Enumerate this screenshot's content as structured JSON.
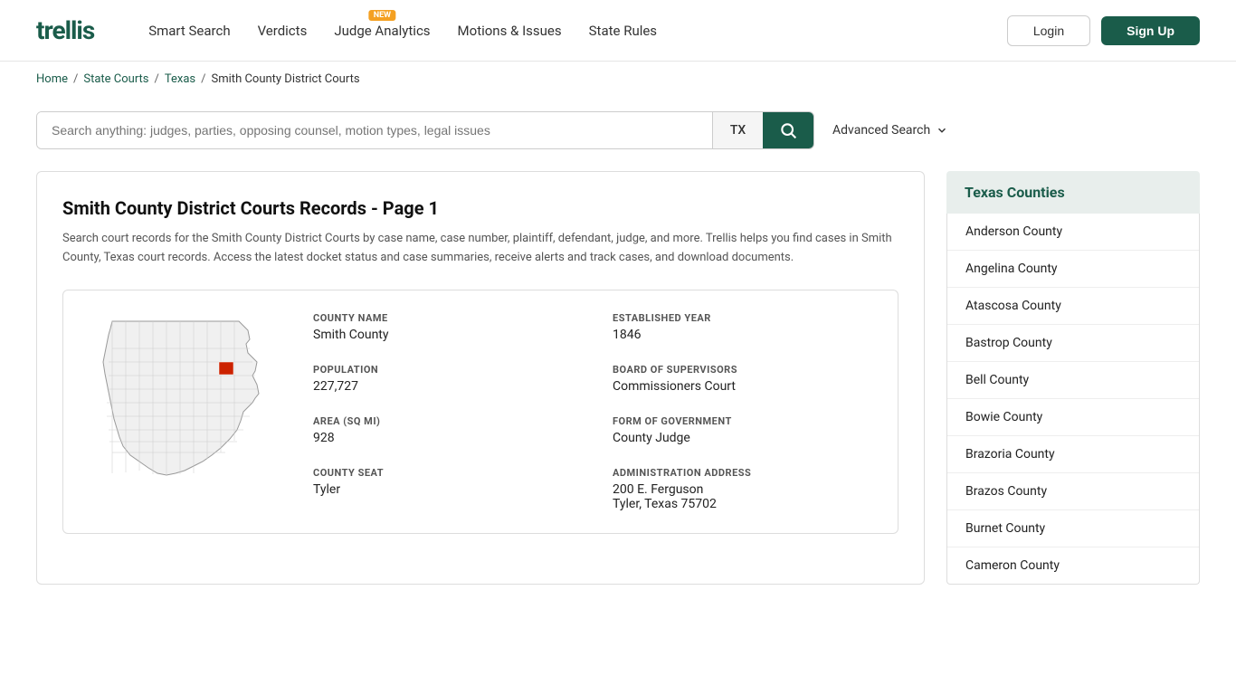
{
  "header": {
    "logo": "trellis",
    "nav": [
      {
        "id": "smart-search",
        "label": "Smart Search",
        "badge": null
      },
      {
        "id": "verdicts",
        "label": "Verdicts",
        "badge": null
      },
      {
        "id": "judge-analytics",
        "label": "Judge Analytics",
        "badge": "NEW"
      },
      {
        "id": "motions-issues",
        "label": "Motions & Issues",
        "badge": null
      },
      {
        "id": "state-rules",
        "label": "State Rules",
        "badge": null
      }
    ],
    "login_label": "Login",
    "signup_label": "Sign Up"
  },
  "breadcrumb": {
    "items": [
      {
        "label": "Home",
        "href": "#"
      },
      {
        "label": "State Courts",
        "href": "#"
      },
      {
        "label": "Texas",
        "href": "#"
      },
      {
        "label": "Smith County District Courts",
        "href": null
      }
    ]
  },
  "search": {
    "placeholder": "Search anything: judges, parties, opposing counsel, motion types, legal issues",
    "state_code": "TX",
    "advanced_label": "Advanced Search"
  },
  "main": {
    "page_title": "Smith County District Courts Records - Page 1",
    "page_desc": "Search court records for the Smith County District Courts by case name, case number, plaintiff, defendant, judge, and more. Trellis helps you find cases in Smith County, Texas court records. Access the latest docket status and case summaries, receive alerts and track cases, and download documents.",
    "county": {
      "name_label": "COUNTY NAME",
      "name_value": "Smith County",
      "population_label": "POPULATION",
      "population_value": "227,727",
      "area_label": "AREA (SQ MI)",
      "area_value": "928",
      "seat_label": "COUNTY SEAT",
      "seat_value": "Tyler",
      "address_label": "ADMINISTRATION ADDRESS",
      "address_line1": "200 E. Ferguson",
      "address_line2": "Tyler, Texas 75702",
      "established_label": "ESTABLISHED YEAR",
      "established_value": "1846",
      "supervisors_label": "BOARD OF SUPERVISORS",
      "supervisors_value": "Commissioners Court",
      "government_label": "FORM OF GOVERNMENT",
      "government_value": "County Judge"
    }
  },
  "sidebar": {
    "header": "Texas Counties",
    "counties": [
      "Anderson County",
      "Angelina County",
      "Atascosa County",
      "Bastrop County",
      "Bell County",
      "Bowie County",
      "Brazoria County",
      "Brazos County",
      "Burnet County",
      "Cameron County"
    ]
  }
}
